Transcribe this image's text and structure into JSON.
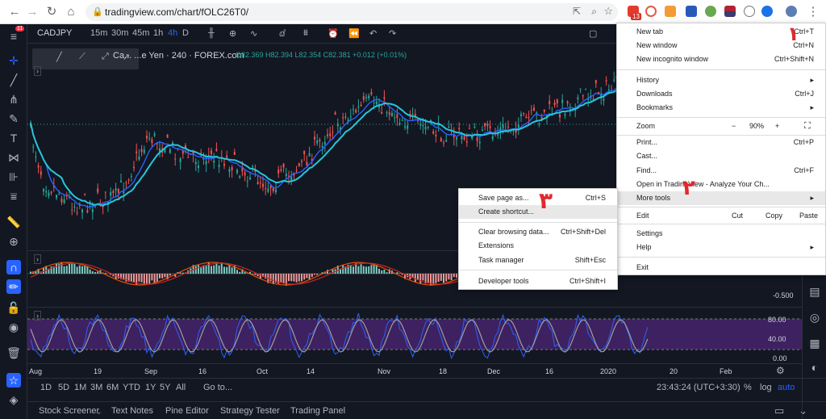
{
  "browser": {
    "url": "tradingview.com/chart/fOLC26T0/",
    "ext_badge": "13"
  },
  "chart": {
    "symbol": "CADJPY",
    "notif_badge": "11",
    "intervals": [
      "15m",
      "30m",
      "45m",
      "1h",
      "4h",
      "D"
    ],
    "active_interval": "4h",
    "legend_title": "Ca... ...e Yen · 240 · FOREX.com",
    "legend_values": "O82.369 H82.394 L82.354 C82.381 +0.012 (+0.01%)",
    "macd_axis": "-0.500",
    "stoch_axis": [
      "80.00",
      "40.00",
      "0.00"
    ],
    "time_labels": [
      "Aug",
      "19",
      "Sep",
      "16",
      "Oct",
      "14",
      "Nov",
      "18",
      "Dec",
      "16",
      "2020",
      "20",
      "Feb"
    ],
    "range_buttons": [
      "1D",
      "5D",
      "1M",
      "3M",
      "6M",
      "YTD",
      "1Y",
      "5Y",
      "All"
    ],
    "goto": "Go to...",
    "clock": "23:43:24 (UTC+3:30)",
    "scale_buttons": [
      "%",
      "log",
      "auto"
    ],
    "bottom_tabs": [
      "Stock Screener",
      "Text Notes",
      "Pine Editor",
      "Strategy Tester",
      "Trading Panel"
    ]
  },
  "chrome_menu": {
    "items": [
      {
        "label": "New tab",
        "shortcut": "Ctrl+T"
      },
      {
        "label": "New window",
        "shortcut": "Ctrl+N"
      },
      {
        "label": "New incognito window",
        "shortcut": "Ctrl+Shift+N"
      },
      {
        "label": "History",
        "shortcut": "▸"
      },
      {
        "label": "Downloads",
        "shortcut": "Ctrl+J"
      },
      {
        "label": "Bookmarks",
        "shortcut": "▸"
      },
      {
        "label": "Zoom",
        "shortcut": ""
      },
      {
        "label": "Print...",
        "shortcut": "Ctrl+P"
      },
      {
        "label": "Cast...",
        "shortcut": ""
      },
      {
        "label": "Find...",
        "shortcut": "Ctrl+F"
      },
      {
        "label": "Open in TradingView - Analyze Your Ch...",
        "shortcut": ""
      },
      {
        "label": "More tools",
        "shortcut": "▸"
      },
      {
        "label": "Edit",
        "shortcut": ""
      },
      {
        "label": "Settings",
        "shortcut": ""
      },
      {
        "label": "Help",
        "shortcut": "▸"
      },
      {
        "label": "Exit",
        "shortcut": ""
      }
    ],
    "zoom_minus": "−",
    "zoom_value": "90%",
    "zoom_plus": "+",
    "edit_cut": "Cut",
    "edit_copy": "Copy",
    "edit_paste": "Paste"
  },
  "more_tools_menu": {
    "items": [
      {
        "label": "Save page as...",
        "shortcut": "Ctrl+S"
      },
      {
        "label": "Create shortcut...",
        "shortcut": ""
      },
      {
        "label": "Clear browsing data...",
        "shortcut": "Ctrl+Shift+Del"
      },
      {
        "label": "Extensions",
        "shortcut": ""
      },
      {
        "label": "Task manager",
        "shortcut": "Shift+Esc"
      },
      {
        "label": "Developer tools",
        "shortcut": "Ctrl+Shift+I"
      }
    ]
  },
  "annotations": [
    "١",
    "٢",
    "٣"
  ],
  "colors": {
    "accent": "#2962ff",
    "annot": "#e0282e",
    "ma1": "#26c6da",
    "ma2": "#2962ff",
    "stoch_band": "#4a2470"
  }
}
